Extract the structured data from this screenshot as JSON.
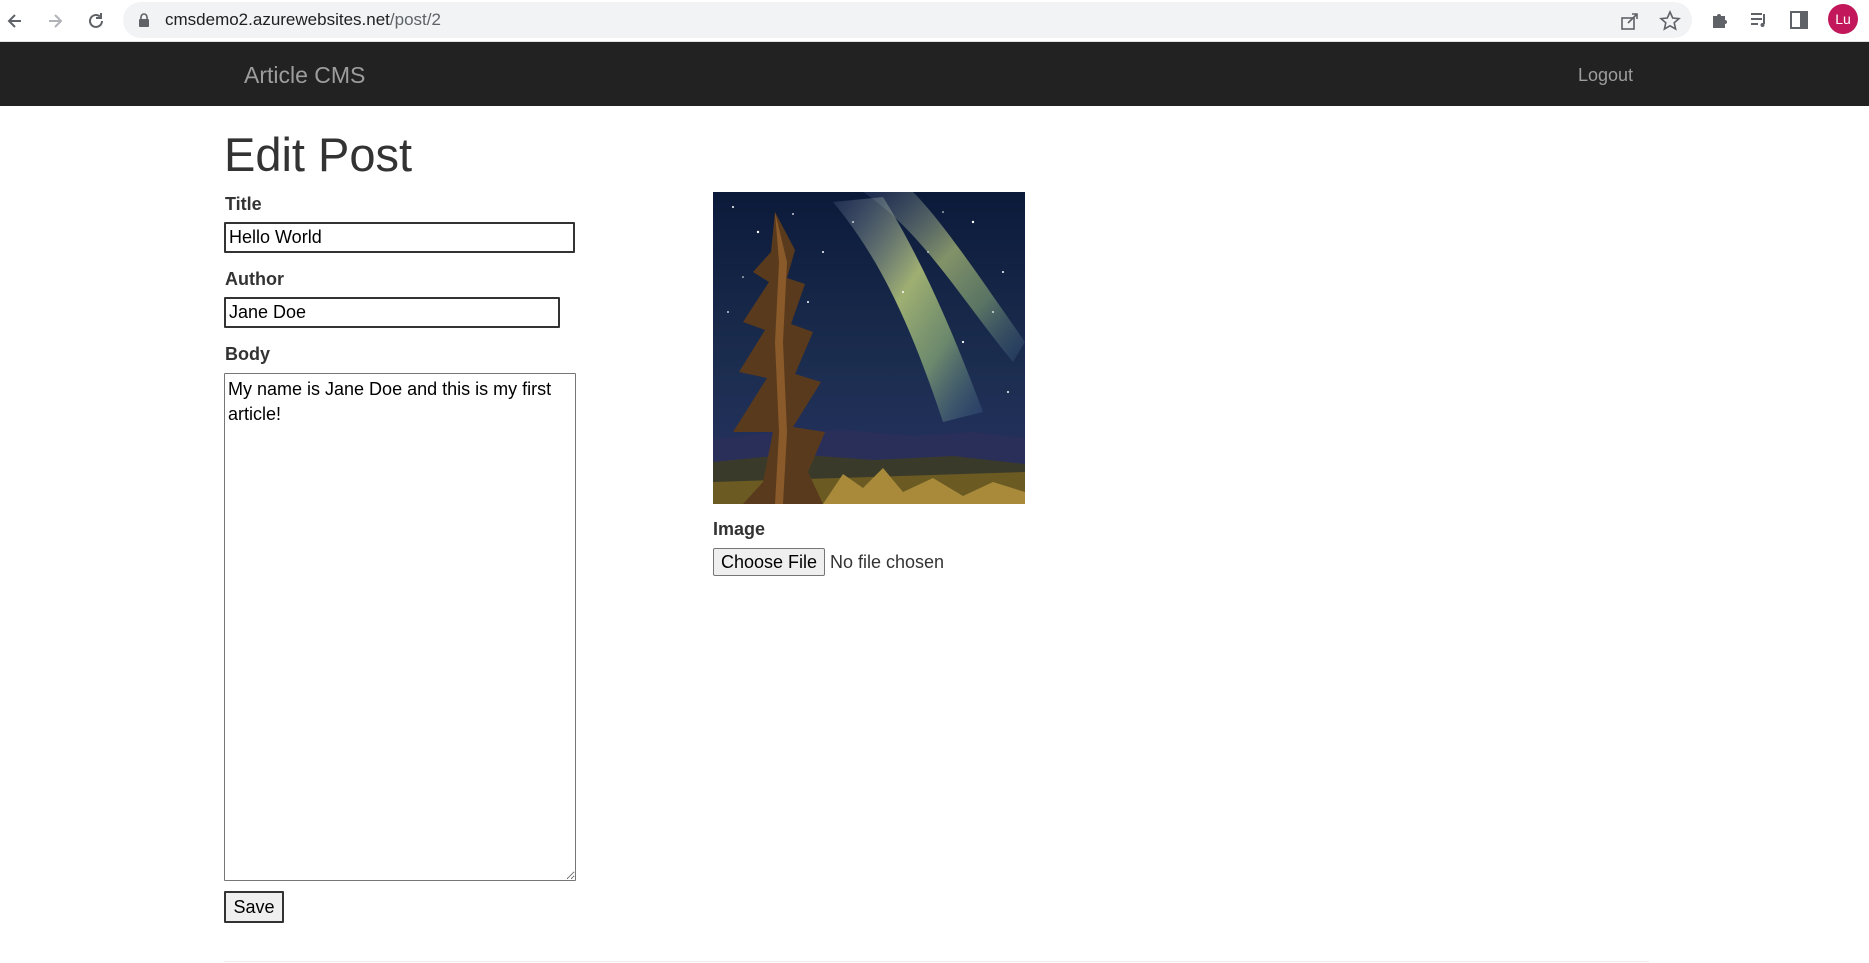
{
  "browser": {
    "url_host": "cmsdemo2.azurewebsites.net",
    "url_path": "/post/2",
    "avatar_initials": "Lu",
    "icons": {
      "back": "back-arrow-icon",
      "forward": "forward-arrow-icon",
      "reload": "reload-icon",
      "lock": "lock-icon",
      "share": "share-icon",
      "bookmark": "star-icon",
      "extensions": "puzzle-icon",
      "media": "media-queue-icon",
      "sidepanel": "side-panel-icon"
    },
    "colors": {
      "avatar_bg": "#c2185b",
      "omnibox_bg": "#f1f3f4"
    }
  },
  "navbar": {
    "brand": "Article CMS",
    "logout": "Logout",
    "colors": {
      "background": "#222222",
      "text": "#9d9d9d"
    }
  },
  "form": {
    "heading": "Edit Post",
    "title_label": "Title",
    "title_value": "Hello World",
    "author_label": "Author",
    "author_value": "Jane Doe",
    "body_label": "Body",
    "body_value": "My name is Jane Doe and this is my first article!",
    "image_label": "Image",
    "choose_file_label": "Choose File",
    "no_file_text": "No file chosen",
    "save_label": "Save",
    "image_description": "starry night sky with milky way over a tall pine tree"
  }
}
